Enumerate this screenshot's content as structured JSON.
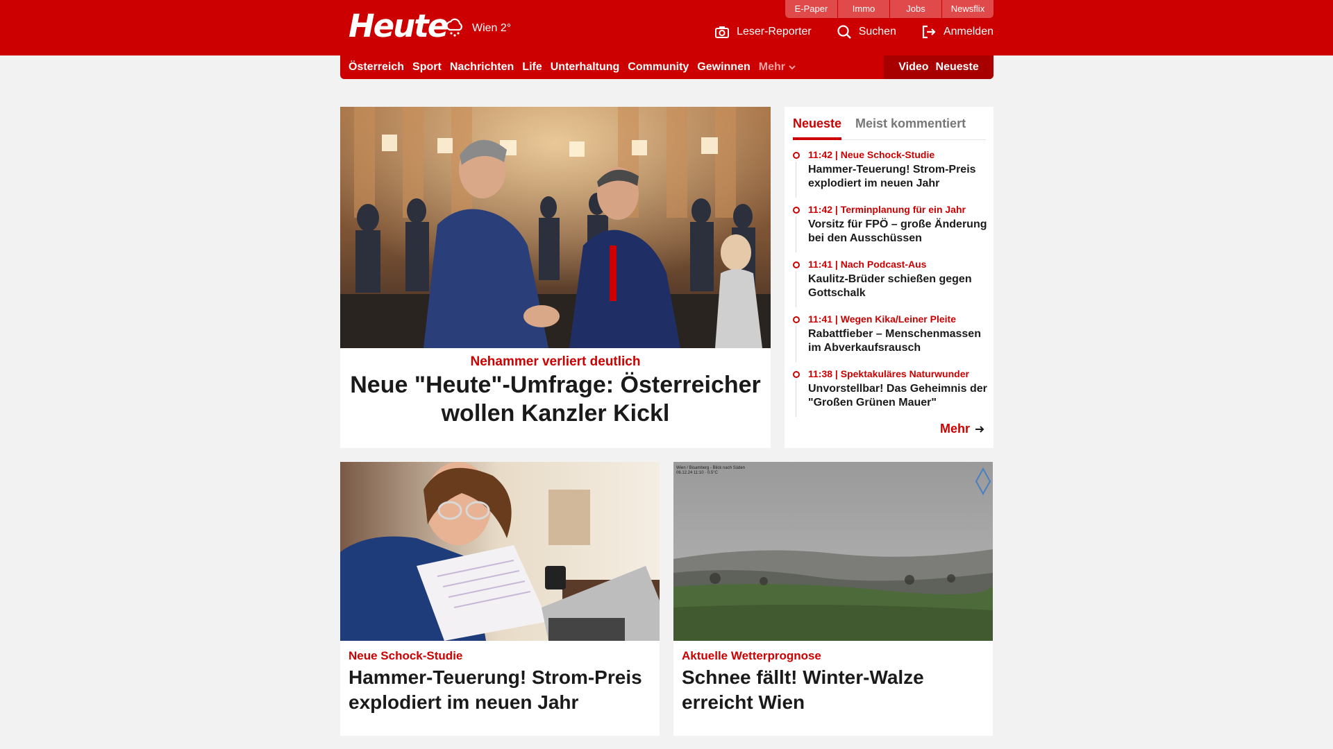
{
  "brand": {
    "logo": "Heute",
    "weather_text": "Wien 2°",
    "accent": "#cc0000"
  },
  "top_tabs": [
    "E-Paper",
    "Immo",
    "Jobs",
    "Newsflix"
  ],
  "header_actions": {
    "reporter": "Leser-Reporter",
    "search": "Suchen",
    "login": "Anmelden"
  },
  "nav": {
    "items": [
      "Österreich",
      "Sport",
      "Nachrichten",
      "Life",
      "Unterhaltung",
      "Community",
      "Gewinnen"
    ],
    "more": "Mehr",
    "right": [
      "Video",
      "Neueste"
    ]
  },
  "hero": {
    "kicker": "Nehammer verliert deutlich",
    "title": "Neue \"Heute\"-Umfrage: Österreicher wollen Kanzler Kickl"
  },
  "sidebar": {
    "tabs": [
      "Neueste",
      "Meist kommentiert"
    ],
    "items": [
      {
        "time": "11:42",
        "kicker": "Neue Schock-Studie",
        "headline": "Hammer-Teuerung! Strom-Preis explodiert im neuen Jahr"
      },
      {
        "time": "11:42",
        "kicker": "Terminplanung für ein Jahr",
        "headline": "Vorsitz für FPÖ – große Änderung bei den Ausschüssen"
      },
      {
        "time": "11:41",
        "kicker": "Nach Podcast-Aus",
        "headline": "Kaulitz-Brüder schießen gegen Gottschalk"
      },
      {
        "time": "11:41",
        "kicker": "Wegen Kika/Leiner Pleite",
        "headline": "Rabattfieber – Menschenmassen im Abverkaufsrausch"
      },
      {
        "time": "11:38",
        "kicker": "Spektakuläres Naturwunder",
        "headline": "Unvorstellbar! Das Geheimnis der \"Großen Grünen Mauer\""
      }
    ],
    "more": "Mehr"
  },
  "cards": [
    {
      "kicker": "Neue Schock-Studie",
      "title": "Hammer-Teuerung! Strom-Preis explodiert im neuen Jahr"
    },
    {
      "kicker": "Aktuelle Wetterprognose",
      "title": "Schnee fällt! Winter-Walze erreicht Wien",
      "cam_caption_1": "Wien / Bisamberg - Blick nach Süden",
      "cam_caption_2": "06.12.24 11:10 · 0.5°C"
    }
  ]
}
